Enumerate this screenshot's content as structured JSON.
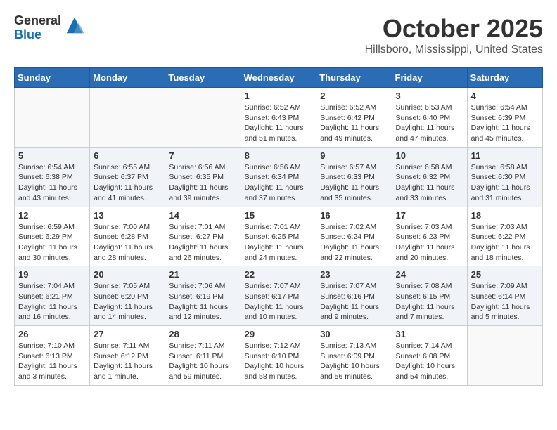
{
  "logo": {
    "general": "General",
    "blue": "Blue"
  },
  "title": "October 2025",
  "location": "Hillsboro, Mississippi, United States",
  "weekdays": [
    "Sunday",
    "Monday",
    "Tuesday",
    "Wednesday",
    "Thursday",
    "Friday",
    "Saturday"
  ],
  "weeks": [
    [
      {
        "day": "",
        "info": ""
      },
      {
        "day": "",
        "info": ""
      },
      {
        "day": "",
        "info": ""
      },
      {
        "day": "1",
        "info": "Sunrise: 6:52 AM\nSunset: 6:43 PM\nDaylight: 11 hours\nand 51 minutes."
      },
      {
        "day": "2",
        "info": "Sunrise: 6:52 AM\nSunset: 6:42 PM\nDaylight: 11 hours\nand 49 minutes."
      },
      {
        "day": "3",
        "info": "Sunrise: 6:53 AM\nSunset: 6:40 PM\nDaylight: 11 hours\nand 47 minutes."
      },
      {
        "day": "4",
        "info": "Sunrise: 6:54 AM\nSunset: 6:39 PM\nDaylight: 11 hours\nand 45 minutes."
      }
    ],
    [
      {
        "day": "5",
        "info": "Sunrise: 6:54 AM\nSunset: 6:38 PM\nDaylight: 11 hours\nand 43 minutes."
      },
      {
        "day": "6",
        "info": "Sunrise: 6:55 AM\nSunset: 6:37 PM\nDaylight: 11 hours\nand 41 minutes."
      },
      {
        "day": "7",
        "info": "Sunrise: 6:56 AM\nSunset: 6:35 PM\nDaylight: 11 hours\nand 39 minutes."
      },
      {
        "day": "8",
        "info": "Sunrise: 6:56 AM\nSunset: 6:34 PM\nDaylight: 11 hours\nand 37 minutes."
      },
      {
        "day": "9",
        "info": "Sunrise: 6:57 AM\nSunset: 6:33 PM\nDaylight: 11 hours\nand 35 minutes."
      },
      {
        "day": "10",
        "info": "Sunrise: 6:58 AM\nSunset: 6:32 PM\nDaylight: 11 hours\nand 33 minutes."
      },
      {
        "day": "11",
        "info": "Sunrise: 6:58 AM\nSunset: 6:30 PM\nDaylight: 11 hours\nand 31 minutes."
      }
    ],
    [
      {
        "day": "12",
        "info": "Sunrise: 6:59 AM\nSunset: 6:29 PM\nDaylight: 11 hours\nand 30 minutes."
      },
      {
        "day": "13",
        "info": "Sunrise: 7:00 AM\nSunset: 6:28 PM\nDaylight: 11 hours\nand 28 minutes."
      },
      {
        "day": "14",
        "info": "Sunrise: 7:01 AM\nSunset: 6:27 PM\nDaylight: 11 hours\nand 26 minutes."
      },
      {
        "day": "15",
        "info": "Sunrise: 7:01 AM\nSunset: 6:25 PM\nDaylight: 11 hours\nand 24 minutes."
      },
      {
        "day": "16",
        "info": "Sunrise: 7:02 AM\nSunset: 6:24 PM\nDaylight: 11 hours\nand 22 minutes."
      },
      {
        "day": "17",
        "info": "Sunrise: 7:03 AM\nSunset: 6:23 PM\nDaylight: 11 hours\nand 20 minutes."
      },
      {
        "day": "18",
        "info": "Sunrise: 7:03 AM\nSunset: 6:22 PM\nDaylight: 11 hours\nand 18 minutes."
      }
    ],
    [
      {
        "day": "19",
        "info": "Sunrise: 7:04 AM\nSunset: 6:21 PM\nDaylight: 11 hours\nand 16 minutes."
      },
      {
        "day": "20",
        "info": "Sunrise: 7:05 AM\nSunset: 6:20 PM\nDaylight: 11 hours\nand 14 minutes."
      },
      {
        "day": "21",
        "info": "Sunrise: 7:06 AM\nSunset: 6:19 PM\nDaylight: 11 hours\nand 12 minutes."
      },
      {
        "day": "22",
        "info": "Sunrise: 7:07 AM\nSunset: 6:17 PM\nDaylight: 11 hours\nand 10 minutes."
      },
      {
        "day": "23",
        "info": "Sunrise: 7:07 AM\nSunset: 6:16 PM\nDaylight: 11 hours\nand 9 minutes."
      },
      {
        "day": "24",
        "info": "Sunrise: 7:08 AM\nSunset: 6:15 PM\nDaylight: 11 hours\nand 7 minutes."
      },
      {
        "day": "25",
        "info": "Sunrise: 7:09 AM\nSunset: 6:14 PM\nDaylight: 11 hours\nand 5 minutes."
      }
    ],
    [
      {
        "day": "26",
        "info": "Sunrise: 7:10 AM\nSunset: 6:13 PM\nDaylight: 11 hours\nand 3 minutes."
      },
      {
        "day": "27",
        "info": "Sunrise: 7:11 AM\nSunset: 6:12 PM\nDaylight: 11 hours\nand 1 minute."
      },
      {
        "day": "28",
        "info": "Sunrise: 7:11 AM\nSunset: 6:11 PM\nDaylight: 10 hours\nand 59 minutes."
      },
      {
        "day": "29",
        "info": "Sunrise: 7:12 AM\nSunset: 6:10 PM\nDaylight: 10 hours\nand 58 minutes."
      },
      {
        "day": "30",
        "info": "Sunrise: 7:13 AM\nSunset: 6:09 PM\nDaylight: 10 hours\nand 56 minutes."
      },
      {
        "day": "31",
        "info": "Sunrise: 7:14 AM\nSunset: 6:08 PM\nDaylight: 10 hours\nand 54 minutes."
      },
      {
        "day": "",
        "info": ""
      }
    ]
  ]
}
